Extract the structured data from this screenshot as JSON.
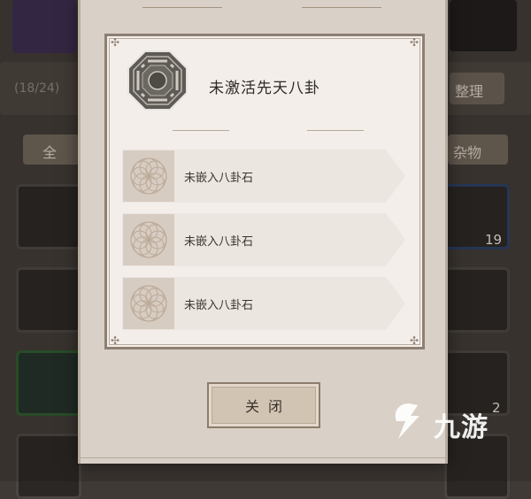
{
  "background": {
    "counter": "(18/24)",
    "sort_label": "整理",
    "tab_all": "全",
    "tab_misc": "杂物",
    "item_count_1": "19",
    "item_count_2": "2"
  },
  "modal": {
    "title": "未激活先天八卦",
    "icon": "bagua-icon",
    "slots": [
      {
        "label": "未嵌入八卦石"
      },
      {
        "label": "未嵌入八卦石"
      },
      {
        "label": "未嵌入八卦石"
      }
    ],
    "close_label": "关闭"
  },
  "watermark": {
    "text": "九游"
  },
  "colors": {
    "panel": "#d9d0c8",
    "inner": "#f3eeea",
    "frame": "#8d7f72",
    "row": "#ede7e2",
    "button": "#d2c4b3"
  }
}
